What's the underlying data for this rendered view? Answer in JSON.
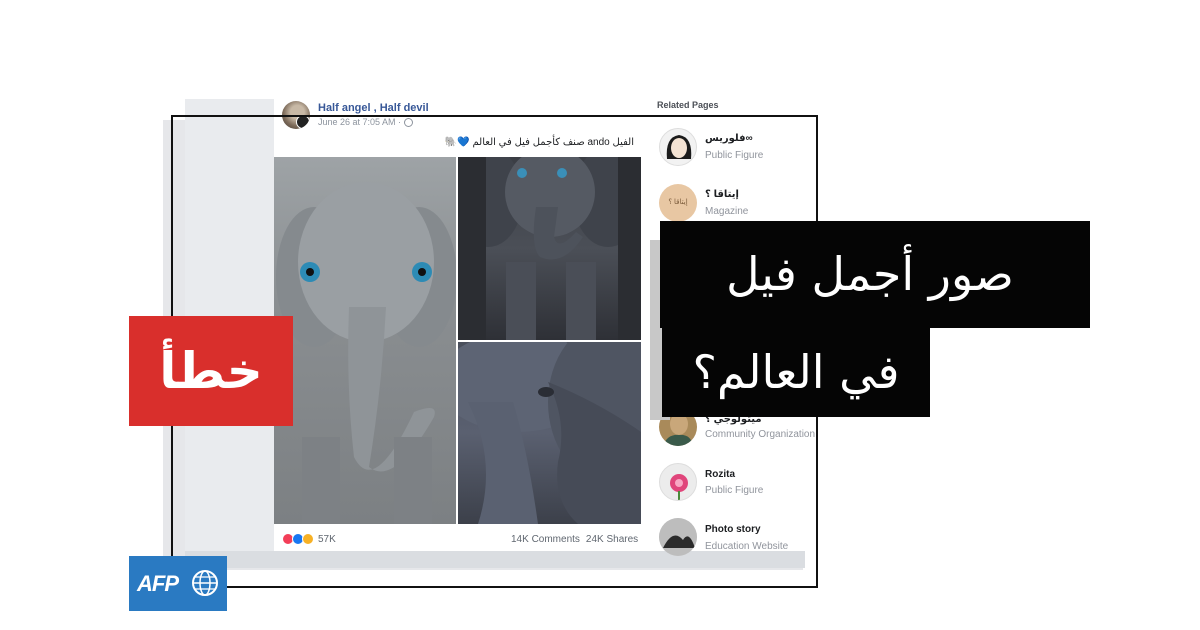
{
  "post": {
    "author": "Half angel , Half devil",
    "meta": "June 26 at 7:05 AM ·",
    "text": "الفيل ando صنف كأجمل فيل في العالم 💙🐘",
    "reaction_count": "57K",
    "comments": "14K Comments",
    "shares": "24K Shares",
    "reactions": [
      "love-icon",
      "like-icon",
      "wow-icon"
    ]
  },
  "related": {
    "title": "Related Pages",
    "pages": [
      {
        "name": "فلوريس∞",
        "category": "Public Figure"
      },
      {
        "name": "إيتاقا ؟",
        "category": "Magazine",
        "avatar_text": "إيتاقا ؟"
      },
      {
        "name": "ميثولوجي ؟",
        "category": "Community Organization"
      },
      {
        "name": "Rozita",
        "category": "Public Figure"
      },
      {
        "name": "Photo story",
        "category": "Education Website"
      }
    ]
  },
  "overlay": {
    "headline_line1": "صور أجمل فيل",
    "headline_line2": "في العالم؟",
    "verdict": "خطأ",
    "logo": "AFP"
  },
  "colors": {
    "verdict_bg": "#d92f2c",
    "headline_bg": "#050505",
    "logo_bg": "#2a7ac2",
    "link": "#385898"
  }
}
